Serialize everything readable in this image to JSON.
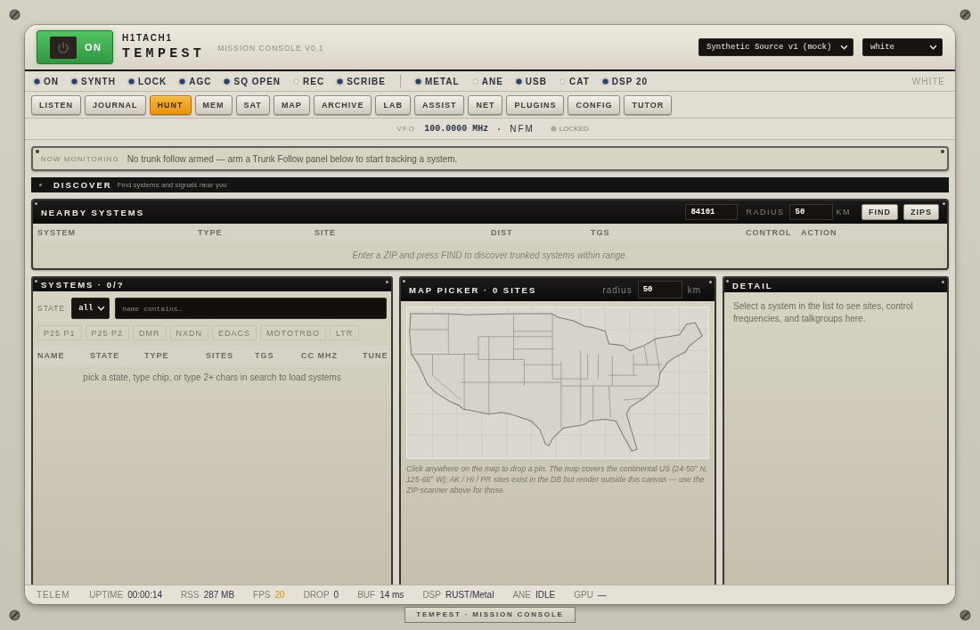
{
  "header": {
    "power": {
      "label": "ON",
      "on": true
    },
    "brand": {
      "maker": "H1TACH1",
      "name": "TEMPEST",
      "subtitle": "MISSION CONSOLE V0.1"
    },
    "selects": [
      {
        "value": "Synthetic Source v1 (mock)"
      },
      {
        "value": "white"
      }
    ]
  },
  "indicators": {
    "groups": [
      [
        {
          "label": "ON",
          "on": true
        },
        {
          "label": "SYNTH",
          "on": true
        },
        {
          "label": "LOCK",
          "on": true
        },
        {
          "label": "AGC",
          "on": true
        },
        {
          "label": "SQ OPEN",
          "on": true
        },
        {
          "label": "REC",
          "on": false
        },
        {
          "label": "SCRIBE",
          "on": true
        }
      ],
      [
        {
          "label": "METAL",
          "on": true
        },
        {
          "label": "ANE",
          "on": false
        },
        {
          "label": "USB",
          "on": true
        },
        {
          "label": "CAT",
          "on": false
        },
        {
          "label": "DSP 20",
          "on": true
        }
      ]
    ],
    "theme": "WHITE"
  },
  "tabs": [
    {
      "label": "LISTEN",
      "selected": false
    },
    {
      "label": "JOURNAL",
      "selected": false
    },
    {
      "label": "HUNT",
      "selected": true
    },
    {
      "label": "MEM",
      "selected": false
    },
    {
      "label": "SAT",
      "selected": false
    },
    {
      "label": "MAP",
      "selected": false
    },
    {
      "label": "ARCHIVE",
      "selected": false
    },
    {
      "label": "LAB",
      "selected": false
    },
    {
      "label": "ASSIST",
      "selected": false
    },
    {
      "label": "NET",
      "selected": false
    },
    {
      "label": "PLUGINS",
      "selected": false
    },
    {
      "label": "CONFIG",
      "selected": false
    },
    {
      "label": "TUTOR",
      "selected": false
    }
  ],
  "vfo": {
    "label": "VFO",
    "frequency": "100.0000 MHz",
    "separator": "·",
    "mode": "NFM",
    "lock": {
      "label": "LOCKED",
      "on": false
    }
  },
  "monitor_banner": {
    "label": "NOW MONITORING",
    "text": "No trunk follow armed — arm a Trunk Follow panel below to start tracking a system."
  },
  "discover": {
    "title": "DISCOVER",
    "subtitle": "Find systems and signals near you"
  },
  "nearby_systems": {
    "title": "NEARBY SYSTEMS",
    "zip": "84101",
    "radius_label": "RADIUS",
    "radius": "50",
    "unit": "KM",
    "buttons": [
      "FIND",
      "ZIPS"
    ],
    "columns": [
      "SYSTEM",
      "TYPE",
      "SITE",
      "DIST",
      "TGS",
      "CONTROL",
      "ACTION"
    ],
    "empty_message": "Enter a ZIP and press FIND to discover trunked systems within range."
  },
  "systems": {
    "title": "SYSTEMS · 0/?",
    "state_label": "STATE",
    "state_value": "all",
    "search_placeholder": "name contains…",
    "chips": [
      {
        "label": "P25 P1",
        "selected": false
      },
      {
        "label": "P25 P2",
        "selected": false
      },
      {
        "label": "DMR",
        "selected": false
      },
      {
        "label": "NXDN",
        "selected": false
      },
      {
        "label": "EDACS",
        "selected": false
      },
      {
        "label": "MOTOTRBO",
        "selected": false
      },
      {
        "label": "LTR",
        "selected": false
      }
    ],
    "columns": [
      "NAME",
      "STATE",
      "TYPE",
      "SITES",
      "TGS",
      "CC MHZ",
      "TUNE"
    ],
    "empty_message": "pick a state, type chip, or type 2+ chars in search to load systems"
  },
  "map_picker": {
    "title": "MAP PICKER · 0 SITES",
    "radius_label": "radius",
    "radius": "50",
    "unit": "km",
    "caption": "Click anywhere on the map to drop a pin. The map covers the continental US (24-50° N, 125-66° W); AK / HI / PR sites exist in the DB but render outside this canvas — use the ZIP scanner above for those."
  },
  "detail": {
    "title": "DETAIL",
    "text": "Select a system in the list to see sites, control frequencies, and talkgroups here."
  },
  "status_bar": {
    "title": "TELEM",
    "items": [
      {
        "label": "UPTIME",
        "value": "00:00:14",
        "warn": false
      },
      {
        "label": "RSS",
        "value": "287 MB",
        "warn": false
      },
      {
        "label": "FPS",
        "value": "20",
        "warn": true
      },
      {
        "label": "DROP",
        "value": "0",
        "warn": false
      },
      {
        "label": "BUF",
        "value": "14 ms",
        "warn": false
      },
      {
        "label": "DSP",
        "value": "RUST/Metal",
        "warn": false
      },
      {
        "label": "ANE",
        "value": "IDLE",
        "warn": false
      },
      {
        "label": "GPU",
        "value": "—",
        "warn": false
      }
    ]
  },
  "footer_plate": "TEMPEST · MISSION CONSOLE"
}
